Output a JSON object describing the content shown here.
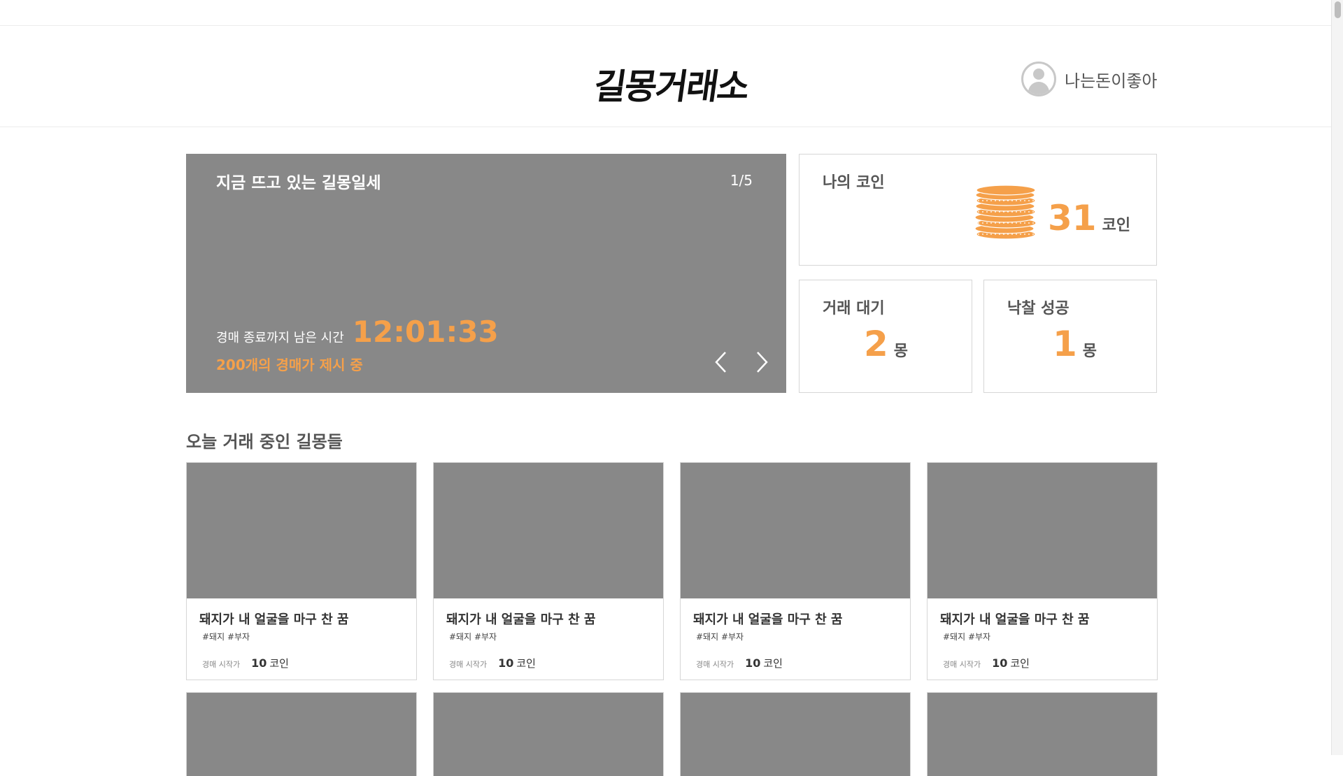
{
  "header": {
    "logo_text": "길몽거래소",
    "user_name": "나는돈이좋아"
  },
  "banner": {
    "title": "지금 뜨고 있는 길몽일세",
    "page": "1/5",
    "countdown_label": "경매 종료까지 남은 시간",
    "countdown": "12:01:33",
    "bids_text": "200개의 경매가 제시 중"
  },
  "coins": {
    "title": "나의 코인",
    "value": "31",
    "unit": "코인"
  },
  "pending": {
    "title": "거래 대기",
    "value": "2",
    "unit": "몽"
  },
  "won": {
    "title": "낙찰 성공",
    "value": "1",
    "unit": "몽"
  },
  "section": {
    "title": "오늘 거래 중인 길몽들"
  },
  "products": [
    {
      "name": "돼지가 내 얼굴을 마구 찬 꿈",
      "tags": "#돼지 #부자",
      "price_label": "경매 시작가",
      "price": "10",
      "price_unit": "코인"
    },
    {
      "name": "돼지가 내 얼굴을 마구 찬 꿈",
      "tags": "#돼지 #부자",
      "price_label": "경매 시작가",
      "price": "10",
      "price_unit": "코인"
    },
    {
      "name": "돼지가 내 얼굴을 마구 찬 꿈",
      "tags": "#돼지 #부자",
      "price_label": "경매 시작가",
      "price": "10",
      "price_unit": "코인"
    },
    {
      "name": "돼지가 내 얼굴을 마구 찬 꿈",
      "tags": "#돼지 #부자",
      "price_label": "경매 시작가",
      "price": "10",
      "price_unit": "코인"
    }
  ],
  "icons": {
    "avatar": "user-avatar-icon",
    "coin": "coin-stack-icon",
    "prev": "chevron-left-icon",
    "next": "chevron-right-icon"
  },
  "colors": {
    "accent": "#f5a04a",
    "placeholder": "#888888",
    "border": "#d6d6d6"
  }
}
